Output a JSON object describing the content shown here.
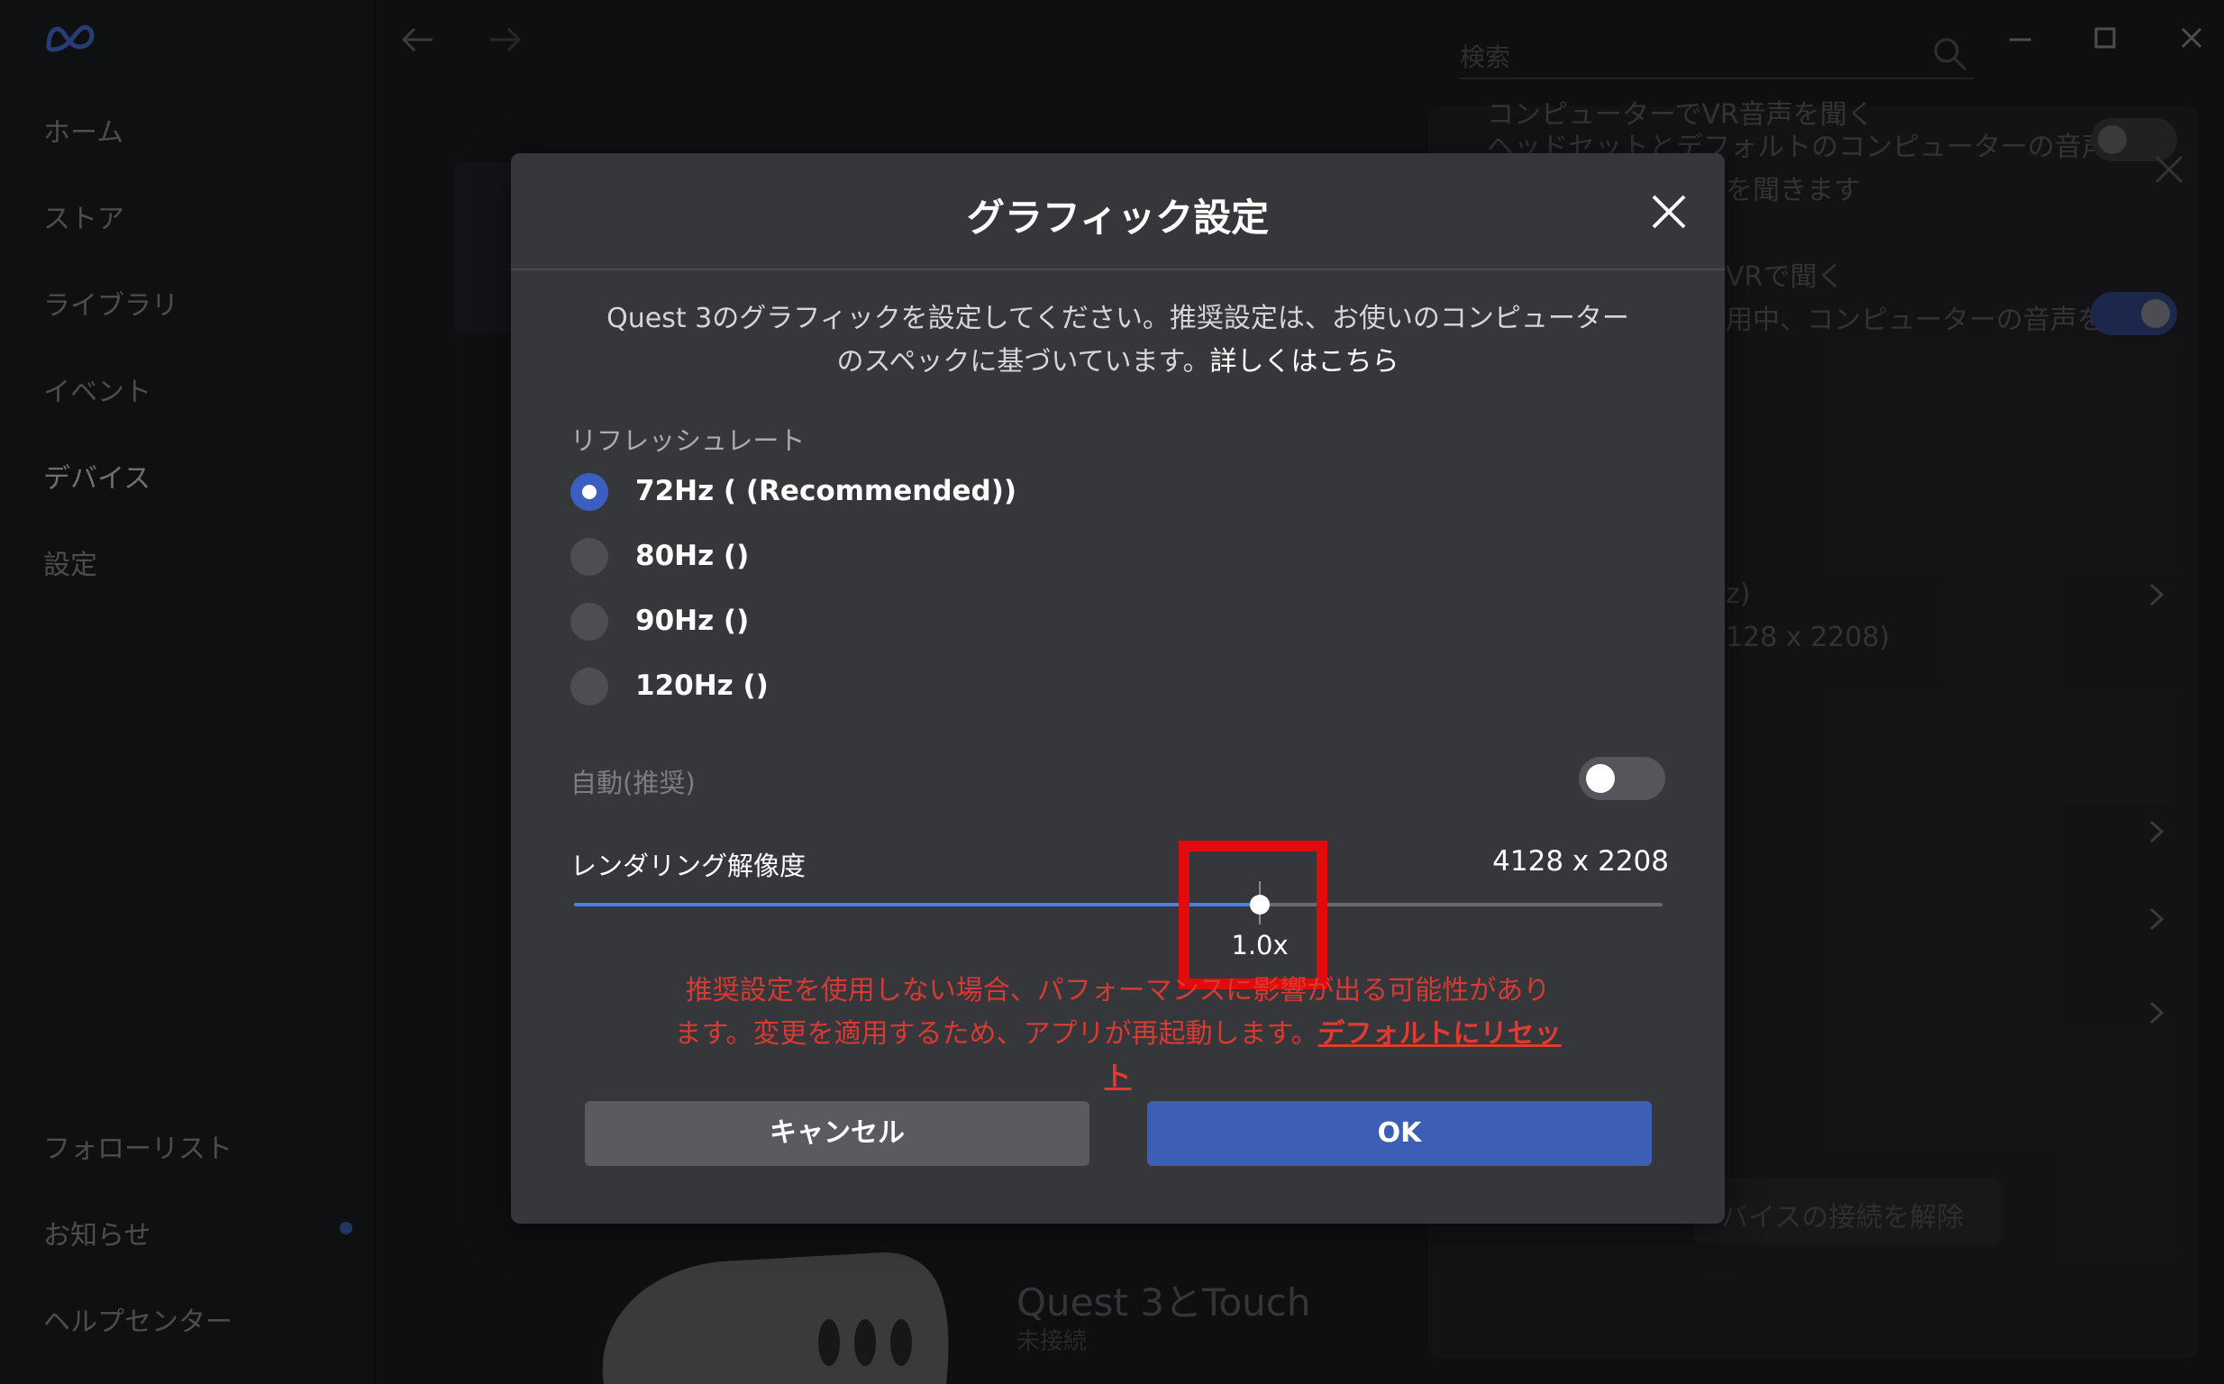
{
  "sidebar": {
    "items": [
      {
        "label": "ホーム"
      },
      {
        "label": "ストア"
      },
      {
        "label": "ライブラリ"
      },
      {
        "label": "イベント"
      },
      {
        "label": "デバイス"
      },
      {
        "label": "設定"
      }
    ],
    "bottom_items": [
      {
        "label": "フォローリスト"
      },
      {
        "label": "お知らせ"
      },
      {
        "label": "ヘルプセンター"
      }
    ]
  },
  "search": {
    "placeholder": "検索"
  },
  "background_panel": {
    "line1": "コンピューターでVR音声を聞く",
    "line2": "ヘッドセットとデフォルトのコンピューターの音声デバ",
    "line3": "を聞きます",
    "line4": "VRで聞く",
    "line5": "用中、コンピューターの音声を",
    "line6": "z)",
    "line7": "128 x 2208)",
    "disconnect_label": "バイスの接続を解除"
  },
  "device": {
    "name": "Quest 3とTouch",
    "status": "未接続"
  },
  "dialog": {
    "title": "グラフィック設定",
    "description": "Quest 3のグラフィックを設定してください。推奨設定は、お使いのコンピューターのスペックに基づいています。",
    "description_link": "詳しくはこちら",
    "refresh_rate_label": "リフレッシュレート",
    "refresh_rates": [
      {
        "label": "72Hz ( (Recommended))",
        "selected": true
      },
      {
        "label": "80Hz ()",
        "selected": false
      },
      {
        "label": "90Hz ()",
        "selected": false
      },
      {
        "label": "120Hz ()",
        "selected": false
      }
    ],
    "auto_label": "自動(推奨)",
    "auto_enabled": false,
    "resolution_label": "レンダリング解像度",
    "resolution_value": "4128 x 2208",
    "slider": {
      "value_label": "1.0x",
      "fraction": 0.63
    },
    "warning": "推奨設定を使用しない場合、パフォーマンスに影響が出る可能性があります。変更を適用するため、アプリが再起動します。",
    "reset_link": "デフォルトにリセット",
    "cancel_label": "キャンセル",
    "ok_label": "OK"
  },
  "colors": {
    "accent": "#3c5eb5",
    "warning": "#d63a33",
    "highlight": "#e20b0b"
  }
}
